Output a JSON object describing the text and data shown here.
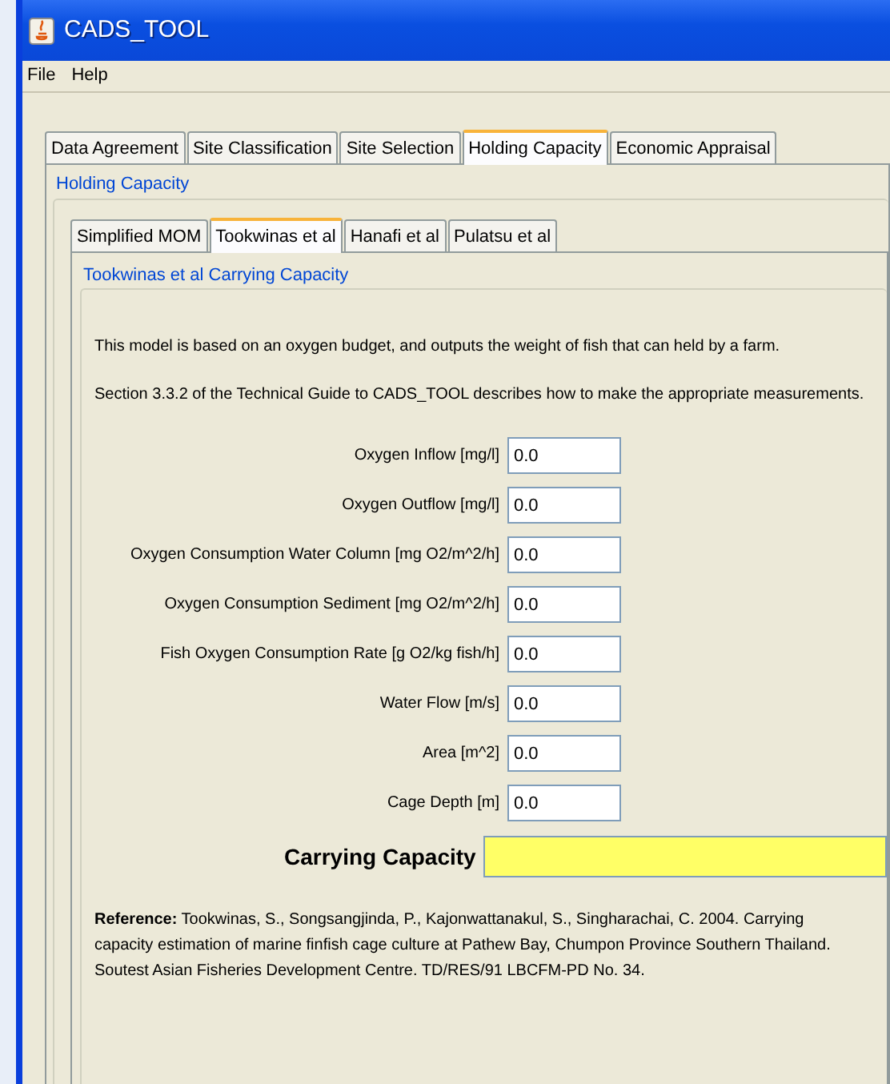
{
  "window": {
    "title": "CADS_TOOL"
  },
  "menu": [
    "File",
    "Help"
  ],
  "tabs": [
    {
      "label": "Data Agreement",
      "selected": false
    },
    {
      "label": "Site Classification",
      "selected": false
    },
    {
      "label": "Site Selection",
      "selected": false
    },
    {
      "label": "Holding Capacity",
      "selected": true
    },
    {
      "label": "Economic Appraisal",
      "selected": false
    }
  ],
  "panel": {
    "title": "Holding Capacity",
    "tabs": [
      {
        "label": "Simplified MOM",
        "selected": false
      },
      {
        "label": "Tookwinas et al",
        "selected": true
      },
      {
        "label": "Hanafi et al",
        "selected": false
      },
      {
        "label": "Pulatsu et al",
        "selected": false
      }
    ],
    "group_title": "Tookwinas et al Carrying Capacity",
    "description": [
      "This model is based on an oxygen budget, and outputs the weight of fish that can held by a farm.",
      "Section 3.3.2 of the Technical Guide to CADS_TOOL describes how to make the appropriate measurements."
    ],
    "fields": [
      {
        "label": "Oxygen Inflow [mg/l]",
        "value": "0.0"
      },
      {
        "label": "Oxygen Outflow [mg/l]",
        "value": "0.0"
      },
      {
        "label": "Oxygen Consumption Water Column [mg O2/m^2/h]",
        "value": "0.0"
      },
      {
        "label": "Oxygen Consumption Sediment [mg O2/m^2/h]",
        "value": "0.0"
      },
      {
        "label": "Fish Oxygen Consumption Rate [g O2/kg fish/h]",
        "value": "0.0"
      },
      {
        "label": "Water Flow [m/s]",
        "value": "0.0"
      },
      {
        "label": "Area [m^2]",
        "value": "0.0"
      },
      {
        "label": "Cage Depth [m]",
        "value": "0.0"
      }
    ],
    "result": {
      "label": "Carrying Capacity"
    },
    "reference": "**Reference:** Tookwinas, S., Songsangjinda, P., Kajonwattanakul, S., Singharachai, C. 2004. Carrying capacity estimation of marine finfish cage culture at Pathew Bay, Chumpon Province Southern Thailand. Soutest Asian Fisheries Development Centre. TD/RES/91 LBCFM-PD No. 34."
  }
}
